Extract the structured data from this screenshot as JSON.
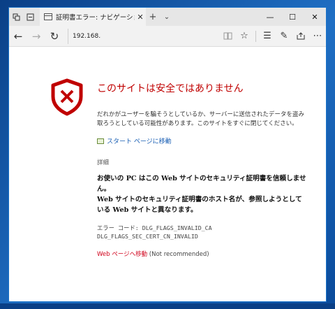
{
  "tab": {
    "title": "証明書エラー: ナビゲーション"
  },
  "address": {
    "url": "192.168."
  },
  "error": {
    "headline": "このサイトは安全ではありません",
    "description": "だれかがユーザーを騙そうとしているか、サーバーに送信されたデータを盗み取ろうとしている可能性があります。このサイトをすぐに閉じてください。",
    "start_link": "スタート ページに移動",
    "details_label": "詳細",
    "explanation_line1": "お使いの PC はこの Web サイトのセキュリティ証明書を信頼しません。",
    "explanation_line2": "Web サイトのセキュリティ証明書のホスト名が、参照しようとしている Web サイトと異なります。",
    "code_line1": "エラー コード: DLG_FLAGS_INVALID_CA",
    "code_line2": "DLG_FLAGS_SEC_CERT_CN_INVALID",
    "go_web_link": "Web ページへ移動",
    "go_web_note": " (Not recommended)"
  },
  "colors": {
    "accent_red": "#c00000",
    "link_blue": "#1a5fb4",
    "warning_link": "#d0021b"
  },
  "icons": [
    "tab-manager-icon",
    "back-tabs-icon",
    "page-icon",
    "close-icon",
    "new-tab-icon",
    "chevron-down-icon",
    "minimize-icon",
    "maximize-icon",
    "window-close-icon",
    "back-arrow-icon",
    "forward-arrow-icon",
    "refresh-icon",
    "reading-view-icon",
    "favorite-star-icon",
    "hub-icon",
    "pen-icon",
    "share-icon",
    "more-icon",
    "shield-error-icon",
    "home-icon"
  ]
}
